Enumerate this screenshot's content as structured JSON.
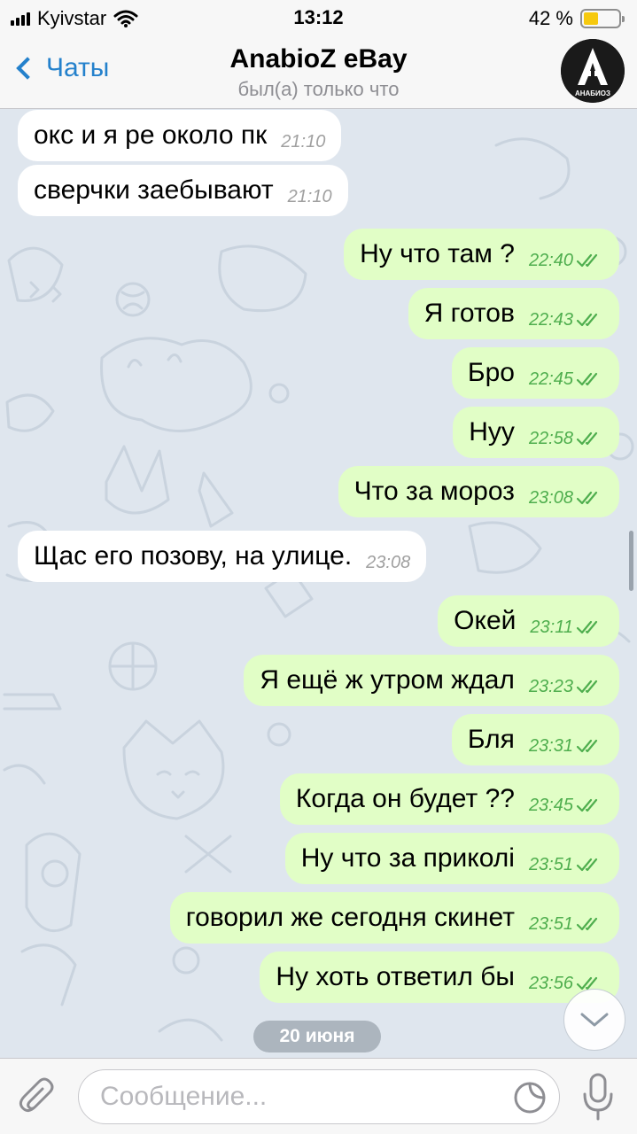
{
  "status_bar": {
    "carrier": "Kyivstar",
    "time": "13:12",
    "battery_percent": "42 %",
    "battery_level": 0.42
  },
  "nav": {
    "back_label": "Чаты",
    "title": "AnabioZ eBay",
    "subtitle": "был(а) только что",
    "avatar_letter": "A",
    "avatar_caption": "АНАБИОЗ"
  },
  "messages": [
    {
      "dir": "in",
      "text": "окс и я ре около пк",
      "time": "21:10"
    },
    {
      "dir": "in",
      "text": "сверчки заебывают",
      "time": "21:10"
    },
    {
      "dir": "out",
      "text": "Ну что там ?",
      "time": "22:40"
    },
    {
      "dir": "out",
      "text": "Я готов",
      "time": "22:43"
    },
    {
      "dir": "out",
      "text": "Бро",
      "time": "22:45"
    },
    {
      "dir": "out",
      "text": "Нуу",
      "time": "22:58"
    },
    {
      "dir": "out",
      "text": "Что за мороз",
      "time": "23:08"
    },
    {
      "dir": "in",
      "text": "Щас его позову, на улице.",
      "time": "23:08"
    },
    {
      "dir": "out",
      "text": "Окей",
      "time": "23:11"
    },
    {
      "dir": "out",
      "text": "Я ещё ж утром ждал",
      "time": "23:23"
    },
    {
      "dir": "out",
      "text": "Бля",
      "time": "23:31"
    },
    {
      "dir": "out",
      "text": "Когда он будет ??",
      "time": "23:45"
    },
    {
      "dir": "out",
      "text": "Ну что за приколі",
      "time": "23:51"
    },
    {
      "dir": "out",
      "text": "говорил же сегодня скинет",
      "time": "23:51"
    },
    {
      "dir": "out",
      "text": "Ну хоть ответил бы",
      "time": "23:56"
    }
  ],
  "date_divider": "20 июня",
  "composer": {
    "placeholder": "Сообщение..."
  },
  "colors": {
    "accent": "#2481cc",
    "outgoing_bubble": "#e1fec6",
    "incoming_bubble": "#ffffff",
    "outgoing_time": "#4fae4e",
    "chat_background": "#dfe6ee"
  }
}
